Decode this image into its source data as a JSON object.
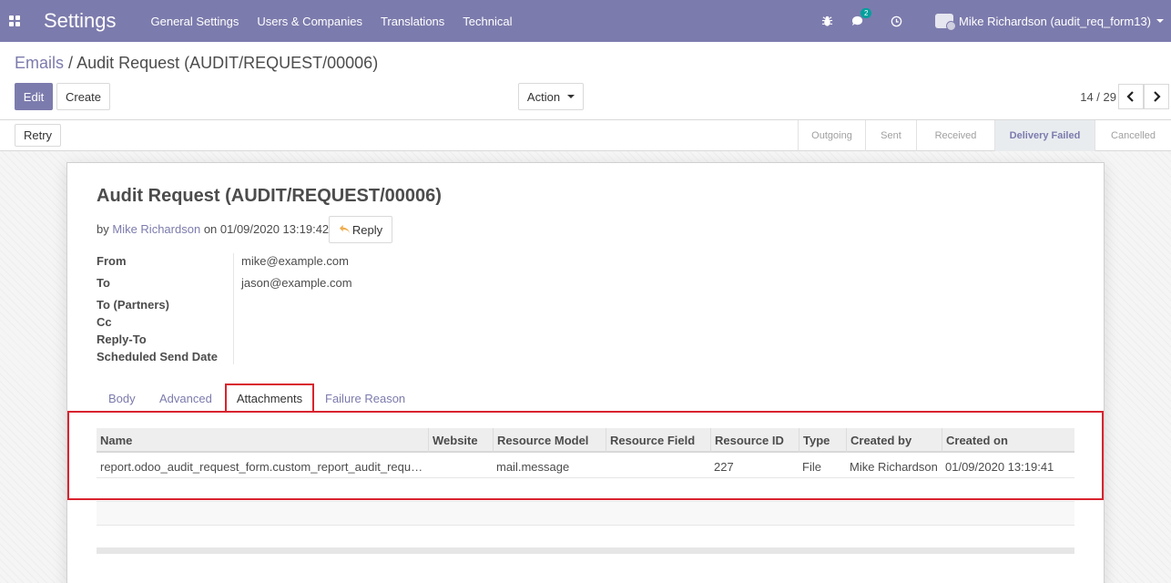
{
  "navbar": {
    "app_title": "Settings",
    "menu": [
      "General Settings",
      "Users & Companies",
      "Translations",
      "Technical"
    ],
    "chat_badge": "2",
    "user_name": "Mike Richardson (audit_req_form13)"
  },
  "breadcrumb": {
    "parent": "Emails",
    "separator": "/",
    "current": "Audit Request (AUDIT/REQUEST/00006)"
  },
  "toolbar": {
    "edit_label": "Edit",
    "create_label": "Create",
    "action_label": "Action",
    "pager": "14 / 29"
  },
  "statusbar": {
    "retry_label": "Retry",
    "stages": [
      "Outgoing",
      "Sent",
      "Received",
      "Delivery Failed",
      "Cancelled"
    ],
    "active_stage": "Delivery Failed"
  },
  "record": {
    "title": "Audit Request (AUDIT/REQUEST/00006)",
    "by_prefix": "by",
    "author": "Mike Richardson",
    "on_text": "on 01/09/2020 13:19:42",
    "reply_label": "Reply",
    "fields": [
      {
        "label": "From",
        "value": "mike@example.com"
      },
      {
        "label": "To",
        "value": "jason@example.com"
      },
      {
        "label": "To (Partners)",
        "value": ""
      },
      {
        "label": "Cc",
        "value": ""
      },
      {
        "label": "Reply-To",
        "value": ""
      },
      {
        "label": "Scheduled Send Date",
        "value": ""
      }
    ]
  },
  "tabs": {
    "body": "Body",
    "advanced": "Advanced",
    "attachments": "Attachments",
    "failure": "Failure Reason"
  },
  "attachments_table": {
    "headers": [
      "Name",
      "Website",
      "Resource Model",
      "Resource Field",
      "Resource ID",
      "Type",
      "Created by",
      "Created on"
    ],
    "rows": [
      [
        "report.odoo_audit_request_form.custom_report_audit_requ…",
        "",
        "mail.message",
        "",
        "227",
        "File",
        "Mike Richardson",
        "01/09/2020 13:19:41"
      ]
    ]
  }
}
